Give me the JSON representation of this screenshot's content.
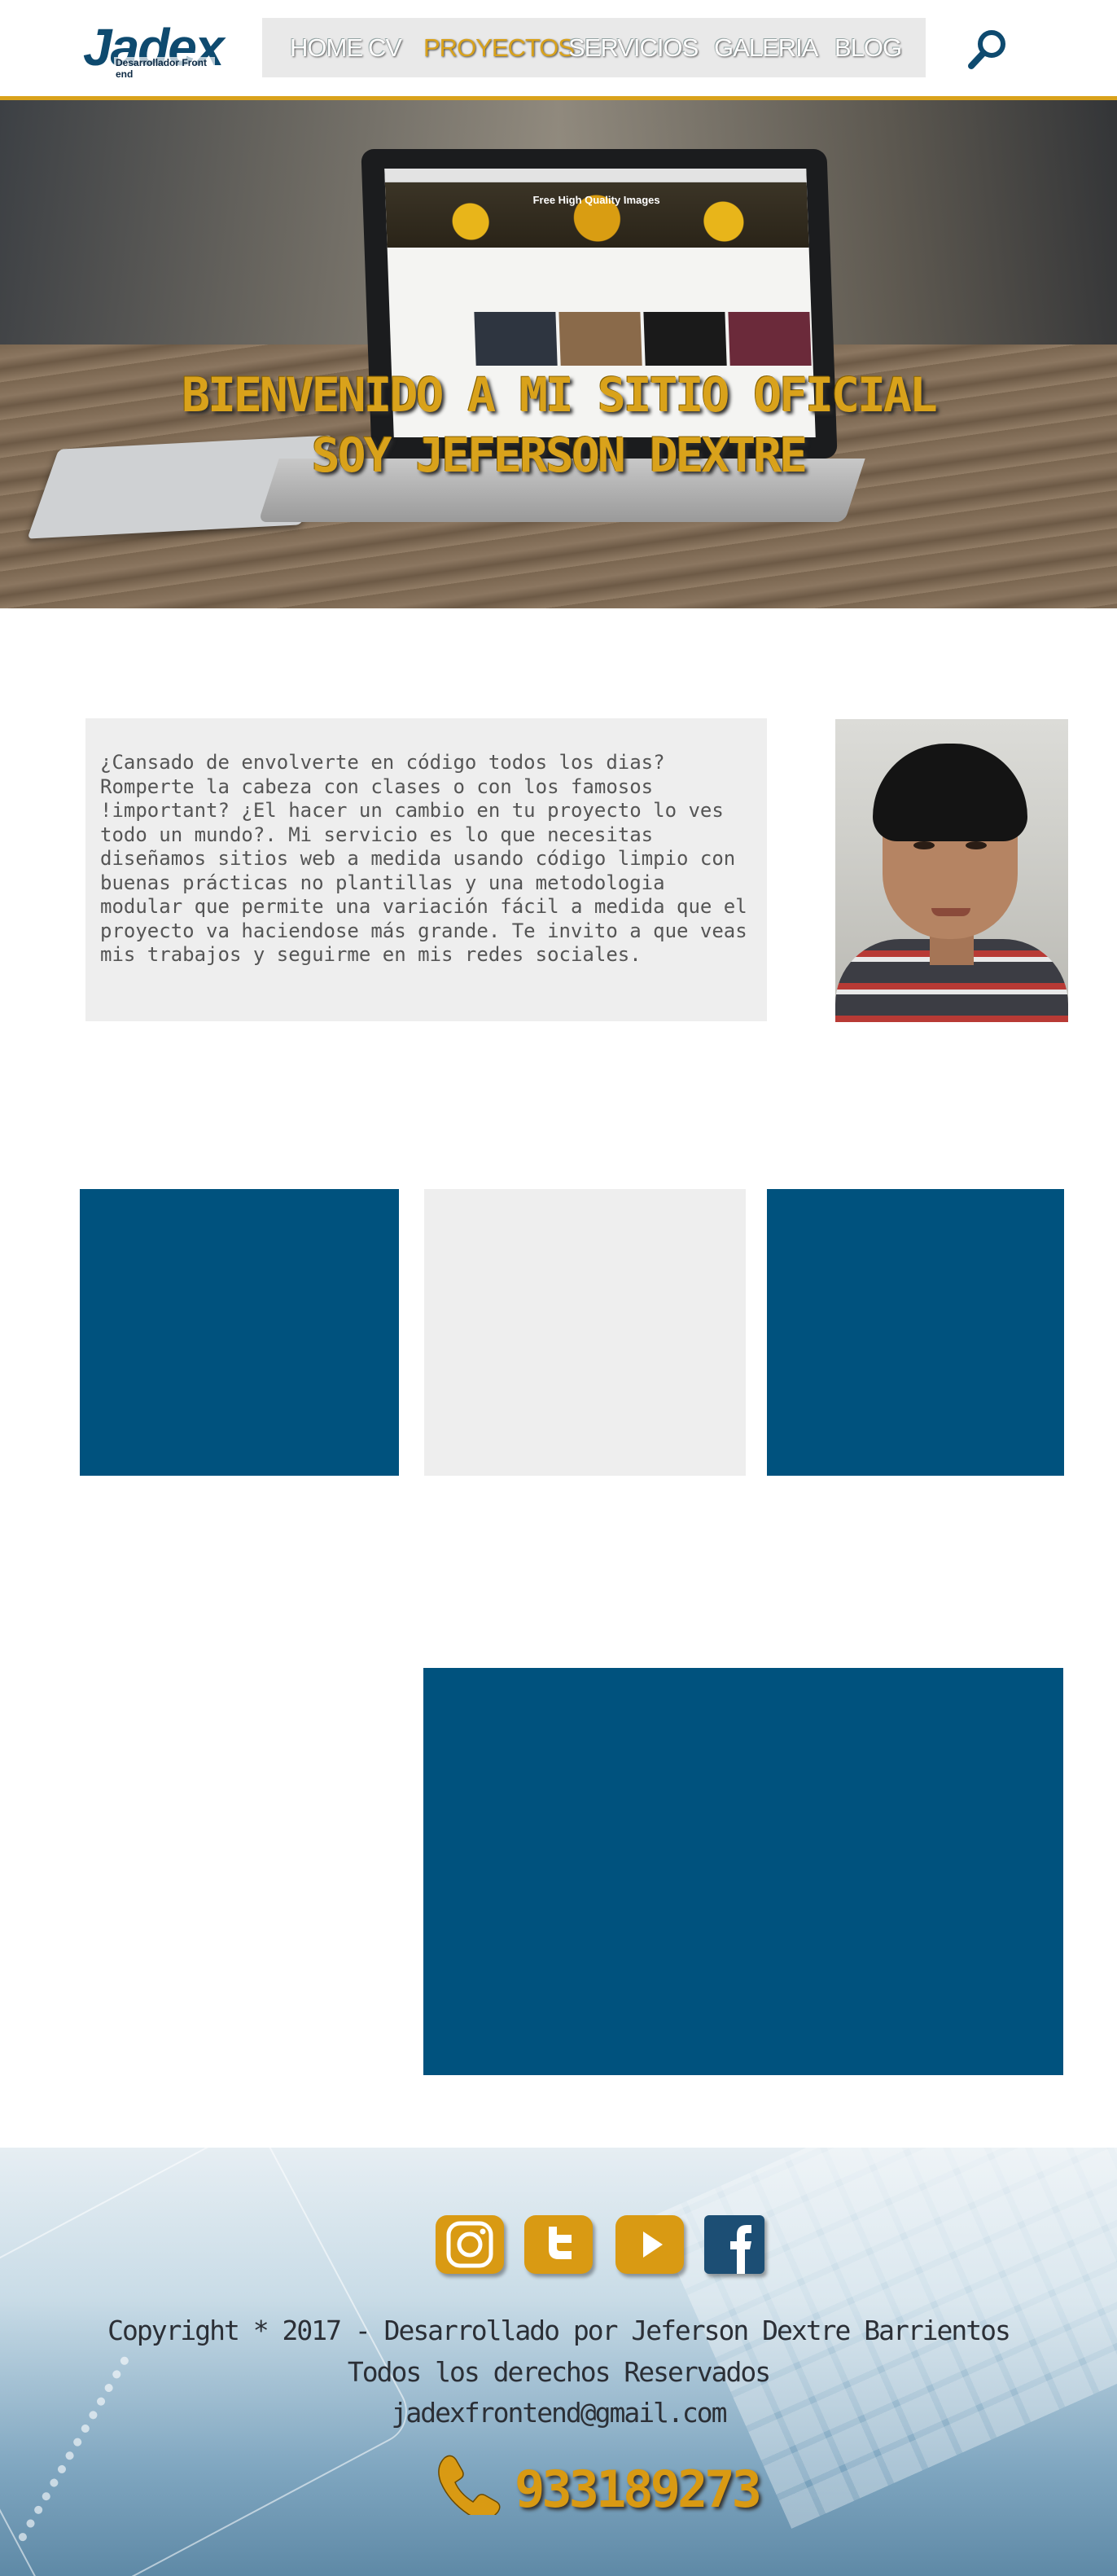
{
  "header": {
    "logo_text": "Jadex",
    "logo_tagline": "Desarrollador Front end",
    "nav": [
      "HOME",
      "CV",
      "PROYECTOS",
      "SERVICIOS",
      "GALERIA",
      "BLOG"
    ],
    "active_nav": "PROYECTOS",
    "search_icon": "search-icon"
  },
  "hero": {
    "line1": "BIENVENIDO A MI SITIO OFICIAL",
    "line2": "SOY JEFERSON DEXTRE",
    "screen_banner": "Free High Quality Images"
  },
  "about": {
    "text": "¿Cansado de envolverte en código todos los dias? Romperte la cabeza con clases o con los famosos !important?  ¿El hacer un cambio en tu proyecto lo ves todo un mundo?. Mi servicio es lo que necesitas diseñamos sitios web a medida  usando código limpio con buenas prácticas no plantillas y una metodologia modular que permite una variación fácil a medida que el proyecto va haciendose más grande. Te invito a que veas mis trabajos y seguirme en mis redes sociales."
  },
  "colors": {
    "accent": "#d9a21b",
    "brand_blue": "#00527e",
    "panel_grey": "#eeeeee"
  },
  "footer": {
    "social_icons": [
      "instagram-icon",
      "twitter-icon",
      "youtube-icon",
      "facebook-icon"
    ],
    "copyright": "Copyright * 2017 - Desarrollado por Jeferson Dextre Barrientos",
    "rights": "Todos los derechos Reservados",
    "email": "jadexfrontend@gmail.com",
    "phone": "933189273"
  }
}
